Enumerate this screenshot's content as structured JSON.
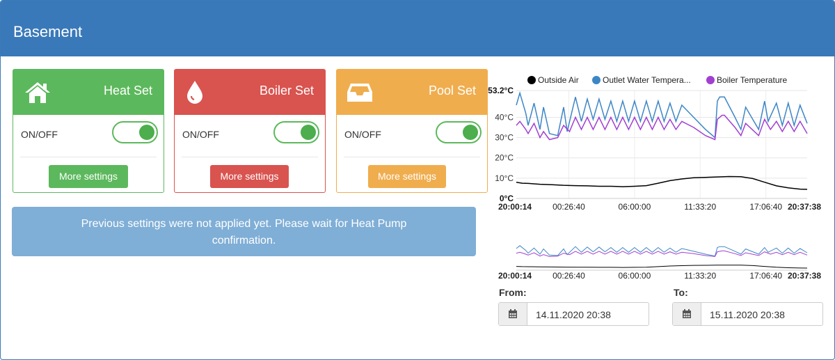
{
  "header": {
    "title": "Basement"
  },
  "cards": [
    {
      "title": "Heat Set",
      "icon": "home-icon",
      "color": "#5cb85c",
      "toggle_label": "ON/OFF",
      "toggle_on": true,
      "button_label": "More settings"
    },
    {
      "title": "Boiler Set",
      "icon": "water-drop-icon",
      "color": "#d9534f",
      "toggle_label": "ON/OFF",
      "toggle_on": true,
      "button_label": "More settings"
    },
    {
      "title": "Pool Set",
      "icon": "inbox-tray-icon",
      "color": "#f0ad4e",
      "toggle_label": "ON/OFF",
      "toggle_on": true,
      "button_label": "More settings"
    }
  ],
  "notice": {
    "line1": "Previous settings were not applied yet. Please wait for Heat Pump",
    "line2": "confirmation."
  },
  "chart_data": {
    "type": "line",
    "legend": [
      {
        "name": "Outside Air",
        "color": "#000000"
      },
      {
        "name": "Outlet Water Tempera...",
        "color": "#3d86c6"
      },
      {
        "name": "Boiler Temperature",
        "color": "#a23fd1"
      }
    ],
    "y_ticks": [
      "0°C",
      "10°C",
      "20°C",
      "30°C",
      "40°C",
      "53.2°C"
    ],
    "ylim": [
      0,
      53.2
    ],
    "x_ticks": [
      "20:00:14",
      "00:26:40",
      "06:00:00",
      "11:33:20",
      "17:06:40",
      "20:37:38"
    ],
    "grid": true,
    "navigator_x_ticks": [
      "20:00:14",
      "00:26:40",
      "06:00:00",
      "11:33:20",
      "17:06:40",
      "20:37:38"
    ],
    "series": [
      {
        "name": "Outside Air",
        "x": [
          0.0,
          0.5,
          1.0,
          2.0,
          3.0,
          4.0,
          5.0,
          6.0,
          7.0,
          8.0,
          9.0,
          10.0,
          11.0,
          12.0,
          13.0,
          14.0,
          15.0,
          16.0,
          17.0,
          18.0,
          19.0,
          20.0,
          21.0,
          22.0,
          23.0,
          24.0,
          24.6
        ],
        "y": [
          8,
          7.5,
          7.4,
          7.0,
          6.8,
          6.5,
          6.3,
          6.2,
          6.0,
          6.0,
          5.8,
          6.0,
          6.3,
          7.5,
          8.8,
          9.6,
          10.2,
          10.4,
          10.6,
          10.8,
          10.7,
          9.8,
          8.0,
          6.2,
          5.2,
          4.6,
          4.5
        ]
      },
      {
        "name": "Outlet Water Temperature",
        "x": [
          0.0,
          0.3,
          0.8,
          1.0,
          1.5,
          2.0,
          2.3,
          2.8,
          3.5,
          4.0,
          4.3,
          5.0,
          5.5,
          6.0,
          6.5,
          7.0,
          7.5,
          8.0,
          8.5,
          9.0,
          9.5,
          10.0,
          10.5,
          11.0,
          11.5,
          12.0,
          12.5,
          13.0,
          13.5,
          14.0,
          15.0,
          16.0,
          16.8,
          17.0,
          17.2,
          17.6,
          18.5,
          19.0,
          19.4,
          20.5,
          21.0,
          21.3,
          22.0,
          22.5,
          23.0,
          23.5,
          24.0,
          24.6
        ],
        "y": [
          46,
          52,
          42,
          36,
          47,
          34,
          45,
          32,
          31,
          45,
          33,
          50,
          38,
          49,
          39,
          49,
          39,
          48,
          38,
          48,
          38,
          48,
          38,
          48,
          38,
          48,
          38,
          47,
          38,
          46,
          40,
          34,
          30,
          48,
          50,
          50,
          40,
          34,
          45,
          34,
          48,
          38,
          47,
          36,
          47,
          36,
          46,
          37
        ]
      },
      {
        "name": "Boiler Temperature",
        "x": [
          0.0,
          0.3,
          0.8,
          1.0,
          1.5,
          2.0,
          2.3,
          2.8,
          3.5,
          4.0,
          4.5,
          5.0,
          5.5,
          6.0,
          6.5,
          7.0,
          7.5,
          8.0,
          8.5,
          9.0,
          9.5,
          10.0,
          10.5,
          11.0,
          11.5,
          12.0,
          12.5,
          13.0,
          13.5,
          14.0,
          15.0,
          16.0,
          16.8,
          17.0,
          17.4,
          17.6,
          18.5,
          19.0,
          19.4,
          20.5,
          21.0,
          21.5,
          22.0,
          22.5,
          23.0,
          23.5,
          24.0,
          24.6
        ],
        "y": [
          36,
          38,
          34,
          32,
          37,
          30,
          33,
          29,
          30,
          36,
          33,
          40,
          34,
          40,
          34,
          40,
          34,
          40,
          34,
          40,
          34,
          40,
          34,
          40,
          34,
          40,
          34,
          39,
          34,
          38,
          35,
          31,
          29,
          39,
          41,
          41,
          35,
          31,
          37,
          31,
          39,
          34,
          38,
          33,
          38,
          33,
          38,
          32
        ]
      }
    ]
  },
  "date_range": {
    "from_label": "From:",
    "from_value": "14.11.2020 20:38",
    "to_label": "To:",
    "to_value": "15.11.2020 20:38"
  }
}
